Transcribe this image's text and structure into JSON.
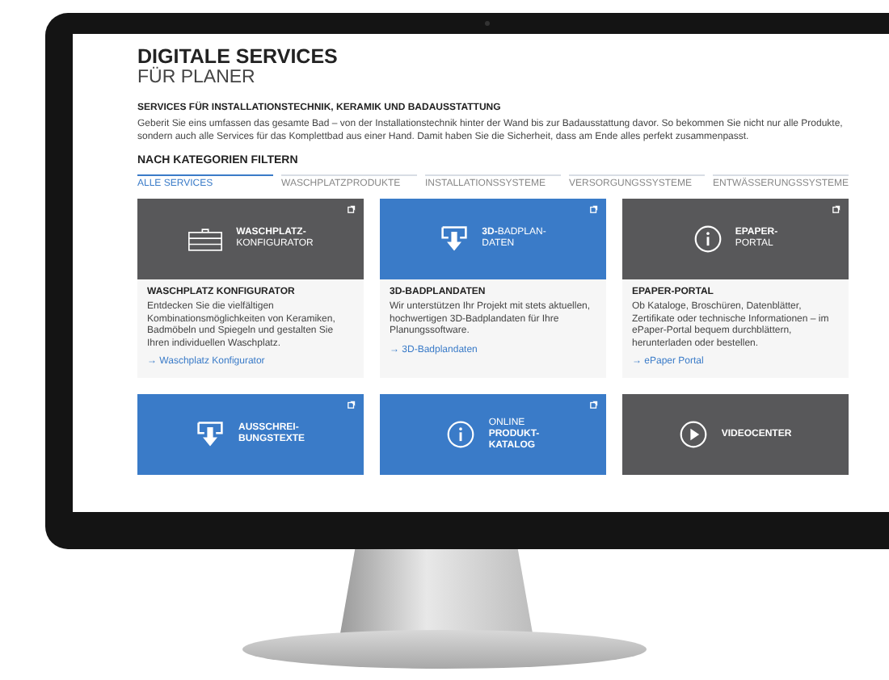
{
  "page": {
    "title": "DIGITALE SERVICES",
    "subtitle": "FÜR PLANER",
    "section_heading": "SERVICES FÜR INSTALLATIONSTECHNIK, KERAMIK UND BADAUSSTATTUNG",
    "intro": "Geberit Sie eins umfassen das gesamte Bad – von der Installationstechnik hinter der Wand bis zur Badausstattung davor. So bekommen Sie nicht nur alle Produkte, sondern auch alle Services für das Komplettbad aus einer Hand. Damit haben Sie die Sicherheit, dass am Ende alles perfekt zusammenpasst.",
    "filter_heading": "NACH KATEGORIEN FILTERN",
    "tabs": [
      {
        "label": "ALLE SERVICES",
        "selected": true
      },
      {
        "label": "WASCHPLATZPRODUKTE",
        "selected": false
      },
      {
        "label": "INSTALLATIONSSYSTEME",
        "selected": false
      },
      {
        "label": "VERSORGUNGSSYSTEME",
        "selected": false
      },
      {
        "label": "ENTWÄSSERUNGSSYSTEME",
        "selected": false
      }
    ],
    "cards": [
      {
        "kind": "configurator",
        "color": "#58585a",
        "external": true,
        "lines": [
          {
            "text": "WASCHPLATZ-",
            "bold": true
          },
          {
            "text": "KONFIGURATOR",
            "bold": false
          }
        ],
        "heading": "WASCHPLATZ KONFIGURATOR",
        "description": "Entdecken Sie die vielfältigen Kombinationsmöglichkeiten von Keramiken, Badmöbeln und Spiegeln und gestalten Sie Ihren individuellen Waschplatz.",
        "link": "→ Waschplatz Konfigurator"
      },
      {
        "kind": "download",
        "color": "#3a7bc8",
        "external": true,
        "lines": [
          {
            "text": "**3D-**BADPLAN-",
            "bold": false
          },
          {
            "text": "DATEN",
            "bold": false
          }
        ],
        "heading": "3D-BADPLANDATEN",
        "description": "Wir unterstützen Ihr Projekt mit stets aktuellen, hochwertigen 3D-Badplandaten für Ihre Planungssoftware.",
        "link": "→ 3D-Badplandaten"
      },
      {
        "kind": "info",
        "color": "#58585a",
        "external": true,
        "lines": [
          {
            "text": "EPAPER-",
            "bold": true
          },
          {
            "text": "PORTAL",
            "bold": false
          }
        ],
        "heading": "EPAPER-PORTAL",
        "description": "Ob Kataloge, Broschüren, Datenblätter, Zertifikate oder technische Informationen – im ePaper-Portal bequem durchblättern, herunterladen oder bestellen.",
        "link": "→ ePaper Portal"
      },
      {
        "kind": "download",
        "color": "#3a7bc8",
        "external": true,
        "lines": [
          {
            "text": "AUSSCHREI-",
            "bold": true
          },
          {
            "text": "BUNGSTEXTE",
            "bold": true
          }
        ]
      },
      {
        "kind": "info",
        "color": "#3a7bc8",
        "external": true,
        "lines": [
          {
            "text": "ONLINE",
            "bold": false
          },
          {
            "text": "PRODUKT-",
            "bold": true
          },
          {
            "text": "KATALOG",
            "bold": true
          }
        ]
      },
      {
        "kind": "video",
        "color": "#58585a",
        "external": false,
        "lines": [
          {
            "text": "VIDEOCENTER",
            "bold": true
          }
        ]
      }
    ]
  }
}
